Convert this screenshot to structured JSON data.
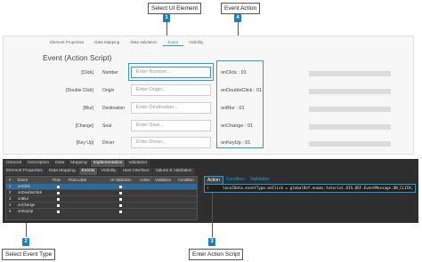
{
  "callouts": {
    "c1": {
      "label": "Select UI Element",
      "num": "1"
    },
    "c2": {
      "label": "Select Event Type",
      "num": "2"
    },
    "c3": {
      "label": "Enter Action Script",
      "num": "3"
    },
    "c4": {
      "label": "Event Action",
      "num": "4"
    }
  },
  "designer": {
    "tabs": [
      "Element Properties",
      "Data Mapping",
      "Data Validation",
      "Event",
      "Visibility"
    ],
    "title": "Event (Action Script)",
    "rows": [
      {
        "event_label": "[Click]",
        "name": "Number",
        "placeholder": "Enter Number...",
        "action": "onClick : 01"
      },
      {
        "event_label": "[Double Click]",
        "name": "Origin",
        "placeholder": "Enter Origin...",
        "action": "onDoubleClick : 01"
      },
      {
        "event_label": "[Blur]",
        "name": "Destination",
        "placeholder": "Enter Destination...",
        "action": "onBlur : 01"
      },
      {
        "event_label": "[Change]",
        "name": "Seat",
        "placeholder": "Enter Seat...",
        "action": "onChange : 01"
      },
      {
        "event_label": "[Key Up]",
        "name": "Driver",
        "placeholder": "Enter Driver...",
        "action": "onKeyUp : 01"
      }
    ]
  },
  "properties": {
    "tabs1": [
      "General",
      "Description",
      "Data",
      "Mapping",
      "Implementation",
      "Validation"
    ],
    "tabs2": [
      "Element Properties",
      "Data Mapping",
      "Events",
      "Visibility",
      "User Interface",
      "Values & Validation"
    ],
    "grid_headers": [
      "#",
      "Event",
      "Flow",
      "Flow Label",
      "UI Validation",
      "Action",
      "Validation",
      "Condition"
    ],
    "grid_rows": [
      {
        "num": "1",
        "event": "onClick"
      },
      {
        "num": "2",
        "event": "onDoubleClick"
      },
      {
        "num": "3",
        "event": "onBlur"
      },
      {
        "num": "4",
        "event": "onChange"
      },
      {
        "num": "5",
        "event": "onKeyUp"
      }
    ],
    "action_tabs": [
      "Action",
      "Condition",
      "Validation"
    ],
    "code_line": "1",
    "code_text": "localData.eventType.onClick = globalDef.enums.tutorial.UIS.DEF.EventMessage.ON_CLICK;"
  }
}
